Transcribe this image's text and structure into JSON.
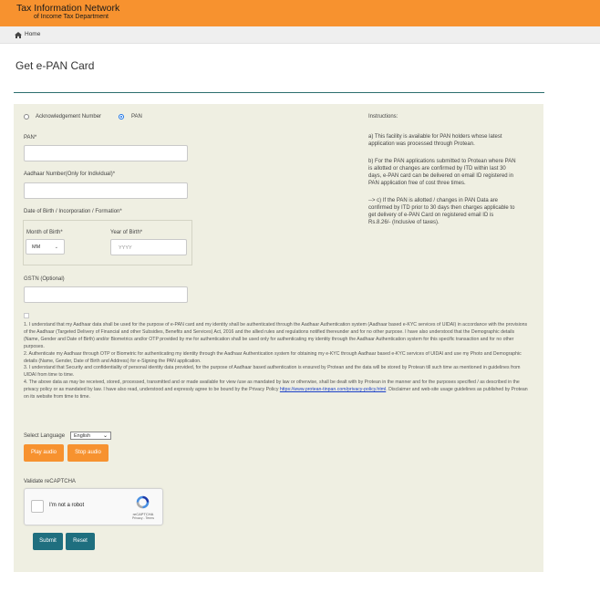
{
  "header": {
    "brand_title": "Tax Information Network",
    "brand_subtitle": "of Income Tax Department",
    "accent_color": "#f7922f"
  },
  "breadcrumb": {
    "home_label": "Home",
    "icon": "home-icon"
  },
  "page": {
    "title": "Get e-PAN Card"
  },
  "form": {
    "radio_ack_label": "Acknowledgement Number",
    "radio_pan_label": "PAN",
    "radio_selected": "PAN",
    "pan_label": "PAN*",
    "pan_value": "",
    "aadhaar_label": "Aadhaar Number(Only for Individual)*",
    "aadhaar_value": "",
    "dob_label": "Date of Birth / Incorporation / Formation*",
    "month_label": "Month of Birth*",
    "month_value": "MM",
    "year_label": "Year of Birth*",
    "year_placeholder": "YYYY",
    "gstn_label": "GSTN (Optional)",
    "gstn_value": ""
  },
  "instructions": {
    "heading": "Instructions:",
    "a_lines": [
      "a) This facility is available for PAN holders whose latest",
      "application was processed through Protean."
    ],
    "b_lines": [
      "b) For the PAN applications submitted to Protean where PAN",
      "is allotted or changes are confirmed by ITD within last 30",
      "days, e-PAN card can be delivered on email ID registered in",
      "PAN application free of cost three times."
    ],
    "c_lines": [
      "--> c) If the PAN is allotted / changes in PAN Data are",
      "confirmed by ITD prior to 30 days then charges applicable to",
      "get delivery of e-PAN Card on registered email ID is",
      "Rs.8.26/- (Inclusive of taxes)."
    ]
  },
  "consent": {
    "p1": "1. I understand that my Aadhaar data shall be used for the purpose of e-PAN card and my identity shall be authenticated through the Aadhaar Authentication system (Aadhaar based e-KYC services of UIDAI) in accordance with the provisions of the Aadhaar (Targeted Delivery of Financial and other Subsidies, Benefits and Services) Act, 2016 and the allied rules and regulations notified thereunder and for no other purpose. I have also understood that the Demographic details (Name, Gender and Date of Birth) and/or Biometrics and/or OTP provided by me for authentication shall be used only for authenticating my identity through the Aadhaar Authentication system for this specific transaction and for no other purposes.",
    "p2": "2. Authenticate my Aadhaar through OTP or Biometric for authenticating my identity through the Aadhaar Authentication system for obtaining my e-KYC through Aadhaar based e-KYC services of UIDAI and use my Photo and Demographic details (Name, Gender, Date of Birth and Address) for e-Signing the PAN application.",
    "p3": "3. I understand that Security and confidentiality of personal identity data provided, for the purpose of Aadhaar based authentication is ensured by Protean and the data will be stored by Protean till such time as mentioned in guidelines from UIDAI from time to time.",
    "p4_before": "4. The above data as may be received, stored, processed, transmitted and or made available for view /use as mandated by law or otherwise, shall be dealt with by Protean in the manner and for the purposes specified / as described in the privacy policy or as mandated by law. I have also read, understood and expressly agree to be bound by the Privacy Policy ",
    "p4_link": "https://www.protean-tinpan.com/privacy-policy.html",
    "p4_after": ". Disclaimer and web-site usage guidelines as published by Protean on its website from time to time."
  },
  "audio": {
    "language_label": "Select Language",
    "language_value": "English",
    "play_label": "Play audio",
    "stop_label": "Stop audio"
  },
  "captcha": {
    "heading": "Validate reCAPTCHA",
    "checkbox_label": "I'm not a robot",
    "brand": "reCAPTCHA",
    "terms": "Privacy - Terms"
  },
  "actions": {
    "submit_label": "Submit",
    "reset_label": "Reset",
    "primary_color": "#1f6f7f"
  }
}
